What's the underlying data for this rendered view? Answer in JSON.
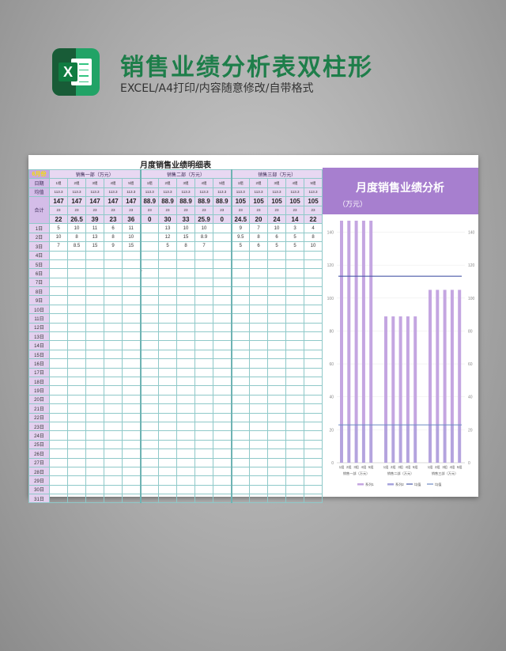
{
  "header": {
    "title": "销售业绩分析表双柱形",
    "subtitle": "EXCEL/A4打印/内容随意修改/自带格式",
    "logo_letter": "X"
  },
  "sheet": {
    "title": "月度销售业绩明细表",
    "month_label": "6月份",
    "date_label": "日期",
    "avg_label": "均值",
    "total_label": "合计",
    "departments": [
      "销售一部（万元）",
      "销售二部（万元）",
      "销售三部（万元）"
    ],
    "groups": [
      "1组",
      "2组",
      "3组",
      "4组",
      "5组"
    ],
    "avg_values": [
      "113.3",
      "113.3",
      "113.3",
      "113.3",
      "113.3",
      "113.3",
      "113.3",
      "113.3",
      "113.3",
      "113.3",
      "113.3",
      "113.3",
      "113.3",
      "113.3",
      "113.3"
    ],
    "totals_row1": [
      "147",
      "147",
      "147",
      "147",
      "147",
      "88.9",
      "88.9",
      "88.9",
      "88.9",
      "88.9",
      "105",
      "105",
      "105",
      "105",
      "105"
    ],
    "small_row": [
      "23",
      "23",
      "23",
      "23",
      "23",
      "23",
      "23",
      "23",
      "23",
      "23",
      "23",
      "23",
      "23",
      "23",
      "23"
    ],
    "totals_row2": [
      "22",
      "26.5",
      "39",
      "23",
      "36",
      "0",
      "30",
      "33",
      "25.9",
      "0",
      "24.5",
      "20",
      "24",
      "14",
      "22"
    ],
    "days": [
      "1日",
      "2日",
      "3日",
      "4日",
      "5日",
      "6日",
      "7日",
      "8日",
      "9日",
      "10日",
      "11日",
      "12日",
      "13日",
      "14日",
      "15日",
      "16日",
      "17日",
      "18日",
      "19日",
      "20日",
      "21日",
      "22日",
      "23日",
      "24日",
      "25日",
      "26日",
      "27日",
      "28日",
      "29日",
      "30日",
      "31日"
    ],
    "day_values": [
      [
        "5",
        "10",
        "11",
        "6",
        "11",
        "",
        "13",
        "10",
        "10",
        "",
        "9",
        "7",
        "10",
        "3",
        "4"
      ],
      [
        "10",
        "8",
        "13",
        "8",
        "10",
        "",
        "12",
        "15",
        "8.9",
        "",
        "9.5",
        "8",
        "6",
        "5",
        "8"
      ],
      [
        "7",
        "8.5",
        "15",
        "9",
        "15",
        "",
        "5",
        "8",
        "7",
        "",
        "5",
        "6",
        "5",
        "5",
        "10"
      ]
    ],
    "stray_mark": "'"
  },
  "chart_panel": {
    "title": "月度销售业绩分析",
    "unit": "（万元）"
  },
  "chart_data": {
    "type": "bar",
    "categories": [
      "1组",
      "2组",
      "3组",
      "4组",
      "5组",
      "1组",
      "2组",
      "3组",
      "4组",
      "5组",
      "1组",
      "2组",
      "3组",
      "4组",
      "5组"
    ],
    "group_labels": [
      "销售一部（万元）",
      "销售二部（万元）",
      "销售三部（万元）"
    ],
    "series": [
      {
        "name": "系列1",
        "type": "bar",
        "values": [
          147,
          147,
          147,
          147,
          147,
          88.9,
          88.9,
          88.9,
          88.9,
          88.9,
          105,
          105,
          105,
          105,
          105
        ]
      },
      {
        "name": "系列2",
        "type": "bar",
        "values": [
          23,
          23,
          23,
          23,
          23,
          23,
          23,
          23,
          23,
          23,
          23,
          23,
          23,
          23,
          23
        ]
      },
      {
        "name": "均值",
        "type": "line",
        "values": [
          113.3,
          113.3,
          113.3,
          113.3,
          113.3,
          113.3,
          113.3,
          113.3,
          113.3,
          113.3,
          113.3,
          113.3,
          113.3,
          113.3,
          113.3
        ]
      },
      {
        "name": "均值",
        "type": "line",
        "values": [
          23,
          23,
          23,
          23,
          23,
          23,
          23,
          23,
          23,
          23,
          23,
          23,
          23,
          23,
          23
        ]
      }
    ],
    "y_ticks": [
      "0",
      "20",
      "40",
      "60",
      "80",
      "100",
      "120",
      "140"
    ],
    "ylim": [
      0,
      147
    ],
    "colors": {
      "bar1": "#c4a6e1",
      "bar2": "#a6a3dd",
      "line1": "#4a5aa8",
      "line2": "#6d8ac4"
    },
    "legend_position": "bottom"
  },
  "colors": {
    "title": "#1e7e4a",
    "header_band": "#a77fcf",
    "grid_line": "#8fc9c9"
  }
}
